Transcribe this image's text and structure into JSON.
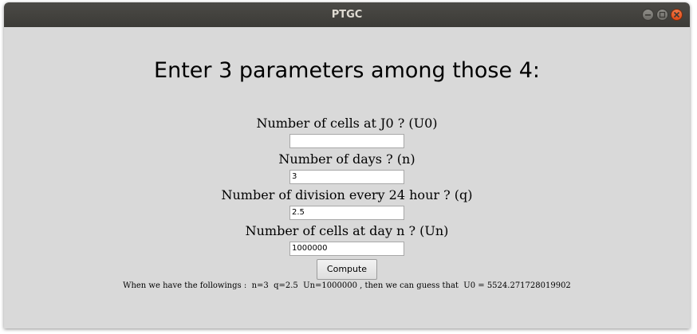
{
  "window": {
    "title": "PTGC"
  },
  "heading": "Enter 3 parameters among those 4:",
  "fields": [
    {
      "label": "Number of cells at J0 ? (U0)",
      "value": ""
    },
    {
      "label": "Number of days ? (n)",
      "value": "3"
    },
    {
      "label": "Number of division every 24 hour ? (q)",
      "value": "2.5"
    },
    {
      "label": "Number of cells at day n ? (Un)",
      "value": "1000000"
    }
  ],
  "compute_label": "Compute",
  "result": "When we have the followings :  n=3  q=2.5  Un=1000000 , then we can guess that  U0 = 5524.271728019902",
  "icons": [
    "minimize-icon",
    "maximize-icon",
    "close-icon"
  ],
  "colors": {
    "titlebar": "#3c3b37",
    "close": "#df4a16",
    "background": "#d9d9d9"
  }
}
